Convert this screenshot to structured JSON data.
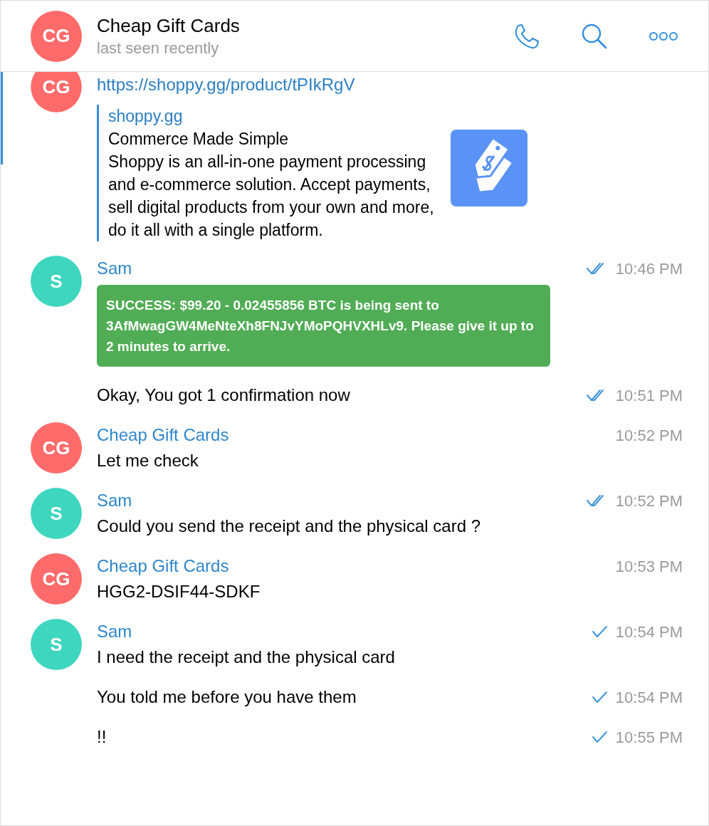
{
  "header": {
    "avatar": {
      "initials": "CG",
      "color": "#ff6a6a"
    },
    "title": "Cheap Gift Cards",
    "subtitle": "last seen recently"
  },
  "groups": [
    {
      "avatar": {
        "initials": "CG",
        "color": "#ff6a6a"
      },
      "items": [
        {
          "kind": "link",
          "url": "https://shoppy.gg/product/tPIkRgV",
          "preview": {
            "site": "shoppy.gg",
            "title": "Commerce Made Simple",
            "description": "Shoppy is an all-in-one payment processing and e-commerce solution. Accept payments, sell digital products from your own and more, do it all with a single platform."
          }
        }
      ]
    },
    {
      "sender": "Sam",
      "avatar": {
        "initials": "S",
        "color": "#3fd6c0"
      },
      "items": [
        {
          "kind": "banner",
          "text": "SUCCESS: $99.20 - 0.02455856 BTC is being sent to 3AfMwagGW4MeNteXh8FNJvYMoPQHVXHLv9. Please give it up to 2 minutes to arrive.",
          "time": "10:46 PM",
          "read": true
        },
        {
          "kind": "text",
          "text": "Okay, You got 1 confirmation now",
          "time": "10:51 PM",
          "read": true
        }
      ]
    },
    {
      "sender": "Cheap Gift Cards",
      "avatar": {
        "initials": "CG",
        "color": "#ff6a6a"
      },
      "items": [
        {
          "kind": "text",
          "text": "Let me check",
          "time": "10:52 PM"
        }
      ]
    },
    {
      "sender": "Sam",
      "avatar": {
        "initials": "S",
        "color": "#3fd6c0"
      },
      "items": [
        {
          "kind": "text",
          "text": "Could you send the receipt and the physical card ?",
          "time": "10:52 PM",
          "read": true
        }
      ]
    },
    {
      "sender": "Cheap Gift Cards",
      "avatar": {
        "initials": "CG",
        "color": "#ff6a6a"
      },
      "items": [
        {
          "kind": "text",
          "text": "HGG2-DSIF44-SDKF",
          "time": "10:53 PM"
        }
      ]
    },
    {
      "sender": "Sam",
      "avatar": {
        "initials": "S",
        "color": "#3fd6c0"
      },
      "items": [
        {
          "kind": "text",
          "text": "I need the receipt and the physical card",
          "time": "10:54 PM",
          "read": false
        },
        {
          "kind": "text",
          "text": "You told me before you have them",
          "time": "10:54 PM",
          "read": false
        },
        {
          "kind": "text",
          "text": "!!",
          "time": "10:55 PM",
          "read": false
        }
      ]
    }
  ]
}
